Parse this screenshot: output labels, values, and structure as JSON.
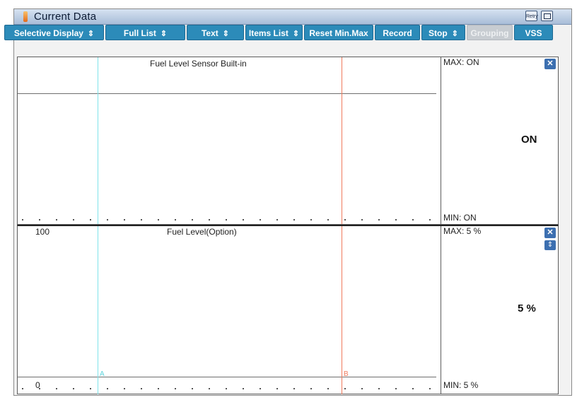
{
  "window": {
    "title": "Current Data",
    "retry_label": "Retry"
  },
  "toolbar": {
    "buttons": [
      {
        "label": "Selective Display",
        "caret": "⇕"
      },
      {
        "label": "Full List",
        "caret": "⇕"
      },
      {
        "label": "Text",
        "caret": "⇕"
      },
      {
        "label": "Items List",
        "caret": "⇕"
      },
      {
        "label": "Reset Min.Max"
      },
      {
        "label": "Record"
      },
      {
        "label": "Stop",
        "caret": "⇕"
      },
      {
        "label": "Grouping",
        "disabled": true
      },
      {
        "label": "VSS"
      }
    ]
  },
  "graphs": [
    {
      "name": "Fuel Level Sensor Built-in",
      "max_label": "MAX: ON",
      "min_label": "MIN: ON",
      "current_value": "ON",
      "y_top": "",
      "y_bottom": ""
    },
    {
      "name": "Fuel Level(Option)",
      "max_label": "MAX:     5 %",
      "min_label": "MIN:     5 %",
      "current_value": "5 %",
      "y_top": "100",
      "y_bottom": "0"
    }
  ],
  "cursors": {
    "a_label": "A",
    "b_label": "B",
    "a_color": "#7fe3ea",
    "b_color": "#f07a5c"
  },
  "icons": {
    "close": "close-icon",
    "reorder": "up-down-icon"
  },
  "colors": {
    "button": "#2c8bb9",
    "disabled": "#c7ccd1",
    "title_gradient_top": "#d6e2f1"
  }
}
